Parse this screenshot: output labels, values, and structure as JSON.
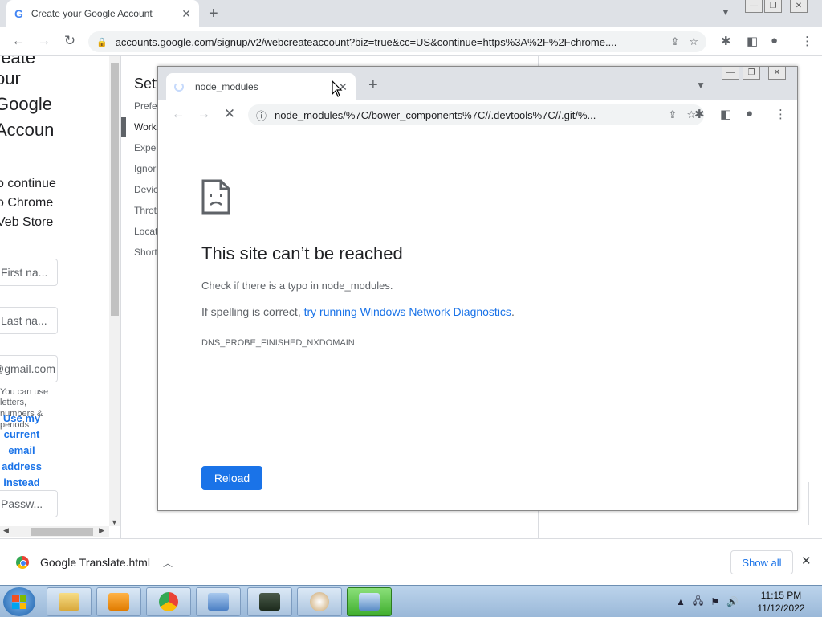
{
  "main_window": {
    "tab_title": "Create your Google Account",
    "tab_icon": "G",
    "url": "accounts.google.com/signup/v2/webcreateaccount?biz=true&cc=US&continue=https%3A%2F%2Fchrome....",
    "page": {
      "heading_lines": [
        "reate",
        "our",
        "Google",
        "Accoun"
      ],
      "continue_lines": [
        "o continue",
        "o Chrome",
        "Veb Store"
      ],
      "first_name_placeholder": "First na...",
      "last_name_placeholder": "Last na...",
      "email_suffix": "@gmail.com",
      "helper_lines": [
        "You can use",
        "letters,",
        "numbers &",
        "periods"
      ],
      "use_current_email_lines": [
        "Use my",
        "current",
        "email",
        "address",
        "instead"
      ],
      "password_placeholder": "Passw..."
    },
    "devtools": {
      "title": "Sett",
      "items": [
        "Prefe",
        "Work",
        "Exper",
        "Ignor",
        "Devic",
        "Throt",
        "Locat",
        "Short"
      ]
    }
  },
  "popup_window": {
    "tab_title": "node_modules",
    "url": "node_modules/%7C/bower_components%7C//.devtools%7C//.git/%...",
    "error": {
      "title": "This site can’t be reached",
      "typo_text": "Check if there is a typo in node_modules.",
      "spelling_prefix": "If spelling is correct, ",
      "spelling_link": "try running Windows Network Diagnostics",
      "spelling_suffix": ".",
      "code": "DNS_PROBE_FINISHED_NXDOMAIN",
      "reload_label": "Reload"
    }
  },
  "download_bar": {
    "file_name": "Google Translate.html",
    "show_all_label": "Show all"
  },
  "taskbar": {
    "time": "11:15 PM",
    "date": "11/12/2022"
  },
  "colors": {
    "accent": "#1a73e8",
    "active_taskbar": "#3fae2e"
  }
}
